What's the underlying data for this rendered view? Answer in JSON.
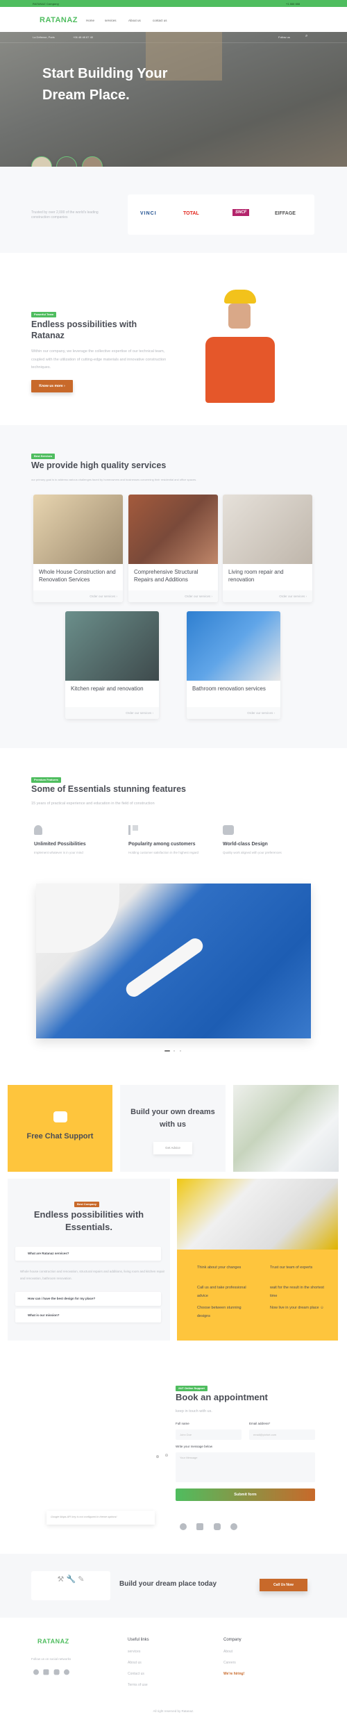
{
  "topbar": {
    "company": "RATANAZ Company",
    "phone": "+1 888 888"
  },
  "nav": {
    "logo": "RATANAZ",
    "items": [
      "Home",
      "services",
      "About us",
      "contact us"
    ]
  },
  "hero": {
    "location": "La Défense, Paris",
    "phone": "+06 48 48 87 40",
    "follow": "Follow us",
    "title_line1": "Start Building Your",
    "title_line2": "Dream Place."
  },
  "trusted": {
    "text": "Trusted by over 2,000 of the world's leading construction companies",
    "logos": [
      "VINCI",
      "TOTAL",
      "SNCF",
      "EIFFAGE"
    ]
  },
  "about": {
    "badge": "Powerful Team",
    "title": "Endless possibilities with Ratanaz",
    "text": "Within our company, we leverage the collective expertise of our technical team, coupled with the utilization of cutting-edge materials and innovative construction techniques.",
    "button": "Know us more ›"
  },
  "services": {
    "badge": "Best Services",
    "title": "We provide high quality services",
    "subtitle": "our primary goal is to address various challenges faced by homeowners and businesses concerning their residential and office spaces.",
    "cta": "Order our services ›",
    "items": [
      {
        "title": "Whole House Construction and Renovation Services"
      },
      {
        "title": "Comprehensive Structural Repairs and Additions"
      },
      {
        "title": "Living room repair and renovation"
      },
      {
        "title": "Kitchen repair and renovation"
      },
      {
        "title": "Bathroom renovation services"
      }
    ]
  },
  "features": {
    "badge": "Premium Features",
    "title": "Some of Essentials stunning features",
    "subtitle": "15 years of practical experience and education in the field of construction",
    "items": [
      {
        "icon": "chair-icon",
        "title": "Unlimited Possibilities",
        "text": "Implement whatever is in your mind"
      },
      {
        "icon": "flag-icon",
        "title": "Popularity among customers",
        "text": "Holding customer satisfaction in the highest regard"
      },
      {
        "icon": "armchair-icon",
        "title": "World-class Design",
        "text": "Quality work aligned with your preferences"
      }
    ]
  },
  "tiles": {
    "chat": "Free Chat Support",
    "dreams": "Build your own dreams with us",
    "advice": "Get Advice"
  },
  "company": {
    "badge": "Best Company",
    "title": "Endless possibilities with Essentials.",
    "faq": [
      {
        "q": "What are Ratanaz services?",
        "a": "Whole house construction and renovation, structural repairs and additions, living room and kitchen repair and renovation, bathroom renovation."
      },
      {
        "q": "How can i have the best design for my place?"
      },
      {
        "q": "What is our mission?"
      }
    ],
    "steps": [
      "Think about your changes",
      "Trust our team of experts",
      "Call us and take professional advice",
      "wait for the result in the shortest time",
      "Choose between stunning designs",
      "Now live in your dream place ☺"
    ]
  },
  "appointment": {
    "badge": "24/7 Online Support",
    "title": "Book an appointment",
    "subtitle": "keep in touch with us.",
    "name_label": "Full name",
    "name_ph": "John Doe",
    "email_label": "Email address*",
    "email_ph": "email@pixfort.com",
    "msg_label": "Write your message below",
    "msg_ph": "Your Message",
    "submit": "Submit form",
    "map_notice": "Google Maps API key is not configured in theme options!"
  },
  "cta": {
    "title": "Build your dream place today",
    "button": "Call Us Now"
  },
  "footer": {
    "follow": "Follow us on social networks",
    "useful_title": "Useful links",
    "useful": [
      "services",
      "About us",
      "Contact us",
      "Terms of use"
    ],
    "company_title": "Company",
    "company": [
      "About",
      "Careers",
      "We're hiring!"
    ],
    "copyright": "All right reserved by Ratanaz."
  },
  "colors": {
    "green": "#4fbd5f",
    "orange": "#c8692a",
    "yellow": "#fec53d"
  }
}
